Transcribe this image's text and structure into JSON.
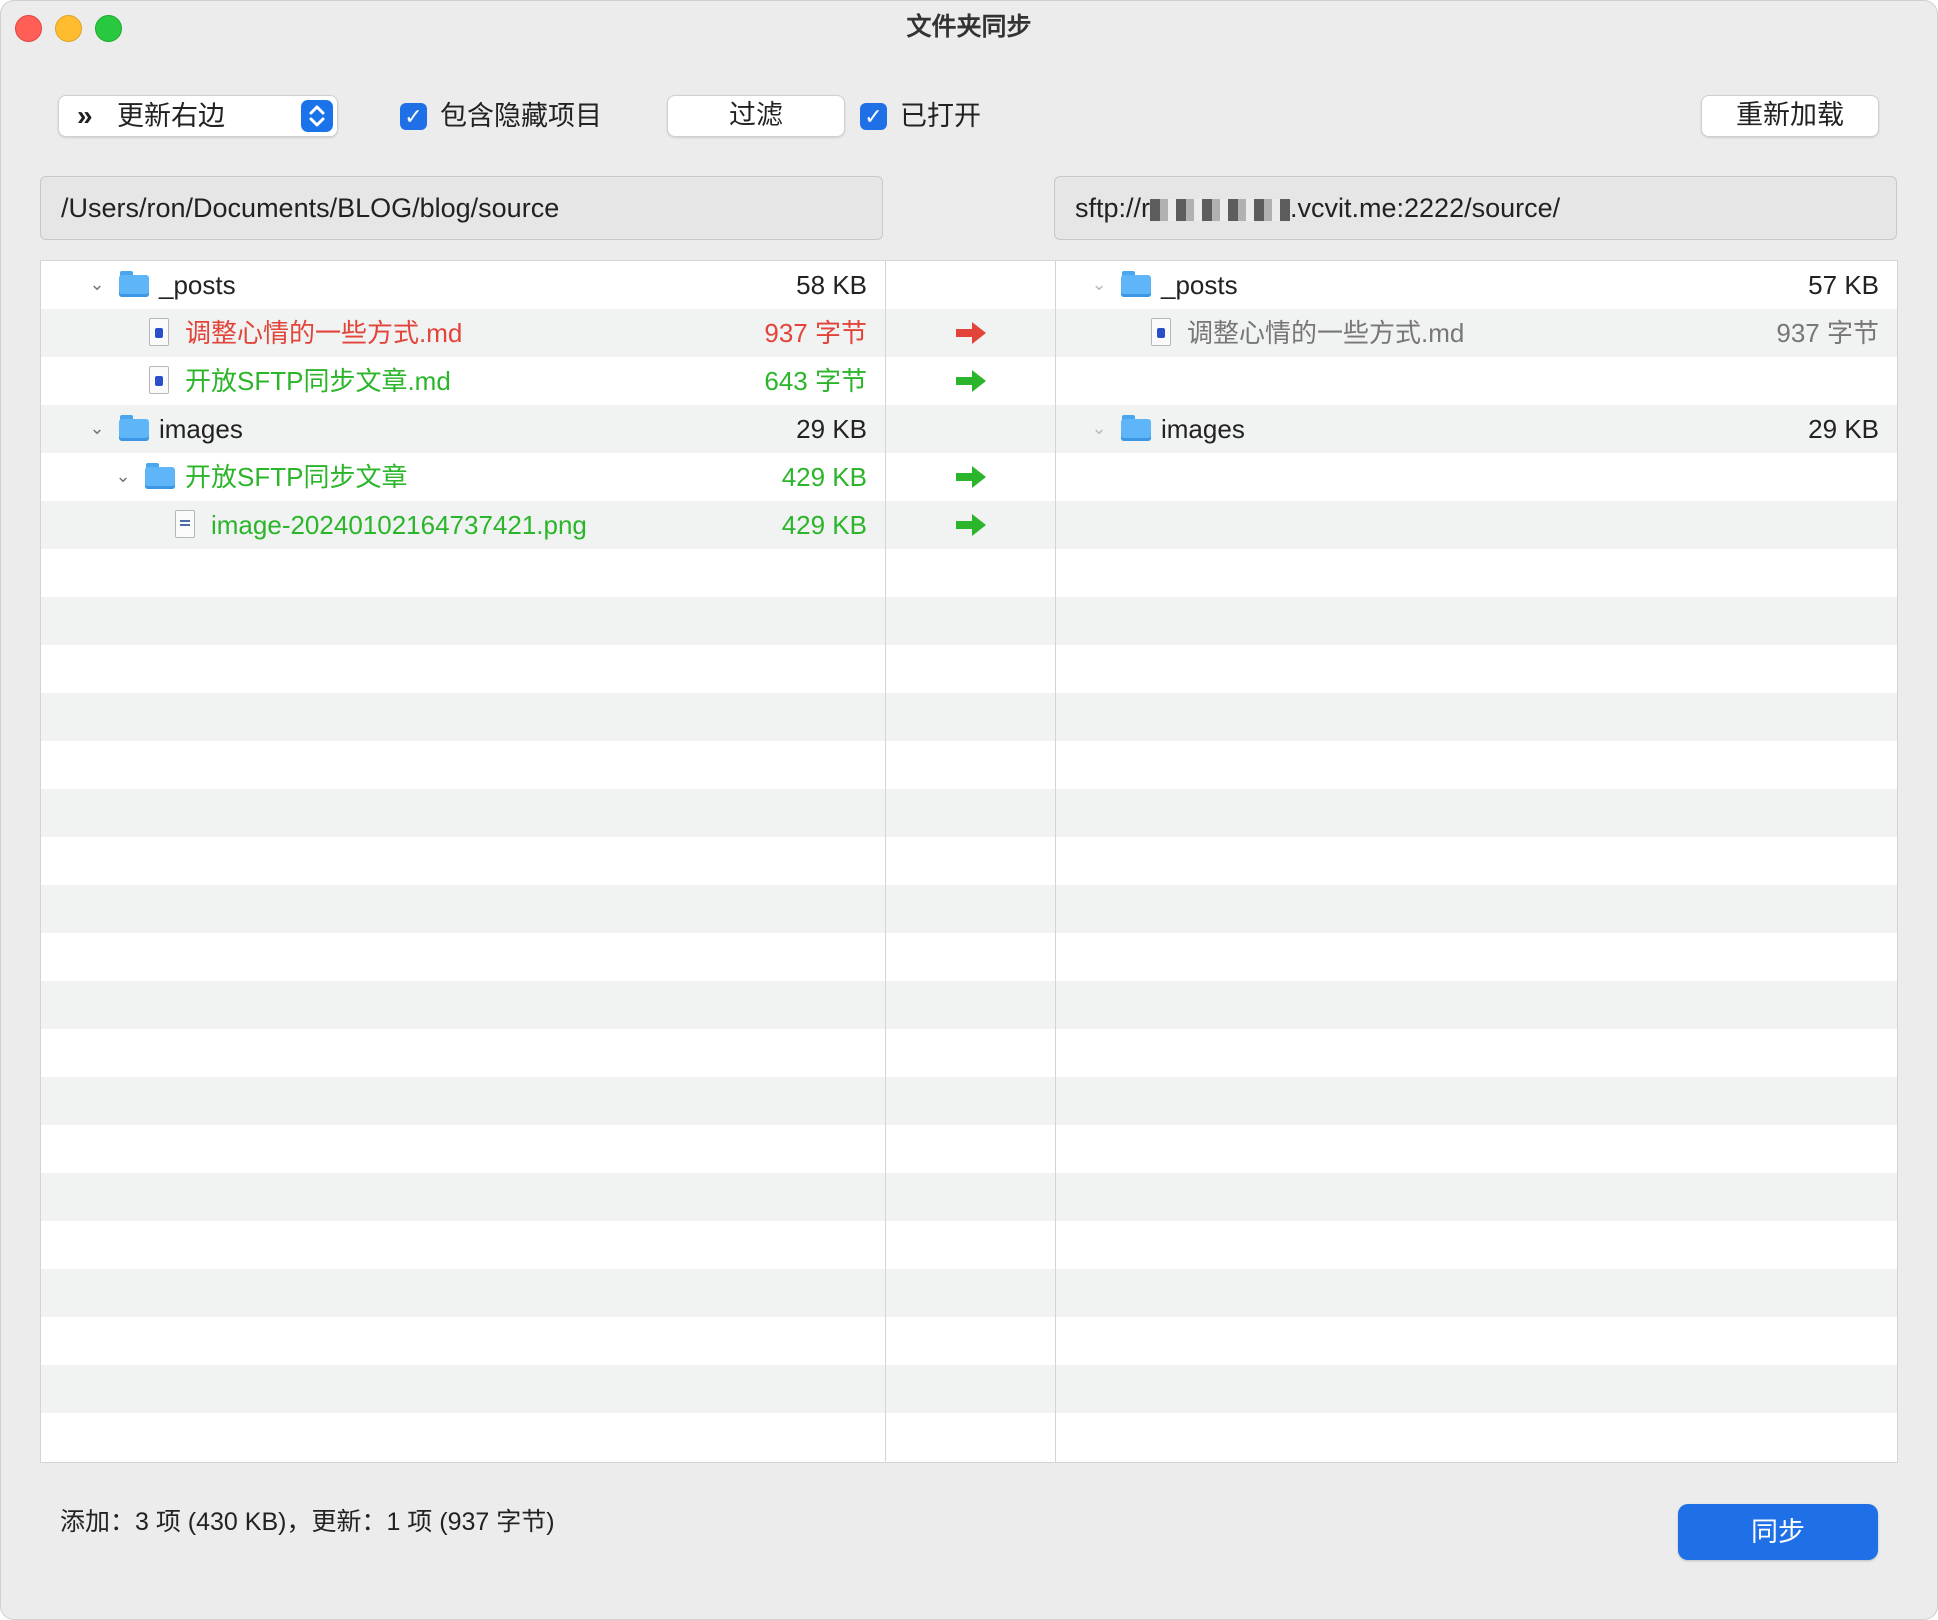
{
  "window": {
    "title": "文件夹同步"
  },
  "toolbar": {
    "mode_label": "更新右边",
    "include_hidden_label": "包含隐藏项目",
    "include_hidden_checked": true,
    "filter_label": "过滤",
    "filter_enabled_label": "已打开",
    "filter_enabled_checked": true,
    "reload_label": "重新加载"
  },
  "paths": {
    "left": "/Users/ron/Documents/BLOG/blog/source",
    "right_prefix": "sftp://r",
    "right_suffix": ".vcvit.me:2222/source/"
  },
  "left_tree": [
    {
      "name": "_posts",
      "size": "58 KB",
      "kind": "folder",
      "depth": 0,
      "color": "black",
      "expanded": true
    },
    {
      "name": "调整心情的一些方式.md",
      "size": "937 字节",
      "kind": "doc",
      "depth": 1,
      "color": "red"
    },
    {
      "name": "开放SFTP同步文章.md",
      "size": "643 字节",
      "kind": "doc",
      "depth": 1,
      "color": "green"
    },
    {
      "name": "images",
      "size": "29 KB",
      "kind": "folder",
      "depth": 0,
      "color": "black",
      "expanded": true
    },
    {
      "name": "开放SFTP同步文章",
      "size": "429 KB",
      "kind": "folder",
      "depth": 1,
      "color": "green",
      "expanded": true
    },
    {
      "name": "image-20240102164737421.png",
      "size": "429 KB",
      "kind": "image",
      "depth": 2,
      "color": "green"
    }
  ],
  "arrows": [
    {
      "row": 1,
      "color": "#e2443a"
    },
    {
      "row": 2,
      "color": "#2bb52a"
    },
    {
      "row": 4,
      "color": "#2bb52a"
    },
    {
      "row": 5,
      "color": "#2bb52a"
    }
  ],
  "right_tree": [
    {
      "row": 0,
      "name": "_posts",
      "size": "57 KB",
      "kind": "folder",
      "depth": 0,
      "color": "black"
    },
    {
      "row": 1,
      "name": "调整心情的一些方式.md",
      "size": "937 字节",
      "kind": "doc",
      "depth": 1,
      "color": "gray"
    },
    {
      "row": 3,
      "name": "images",
      "size": "29 KB",
      "kind": "folder",
      "depth": 0,
      "color": "black"
    }
  ],
  "footer": {
    "status": "添加：3 项 (430 KB)，更新：1 项 (937 字节)",
    "sync_label": "同步"
  }
}
